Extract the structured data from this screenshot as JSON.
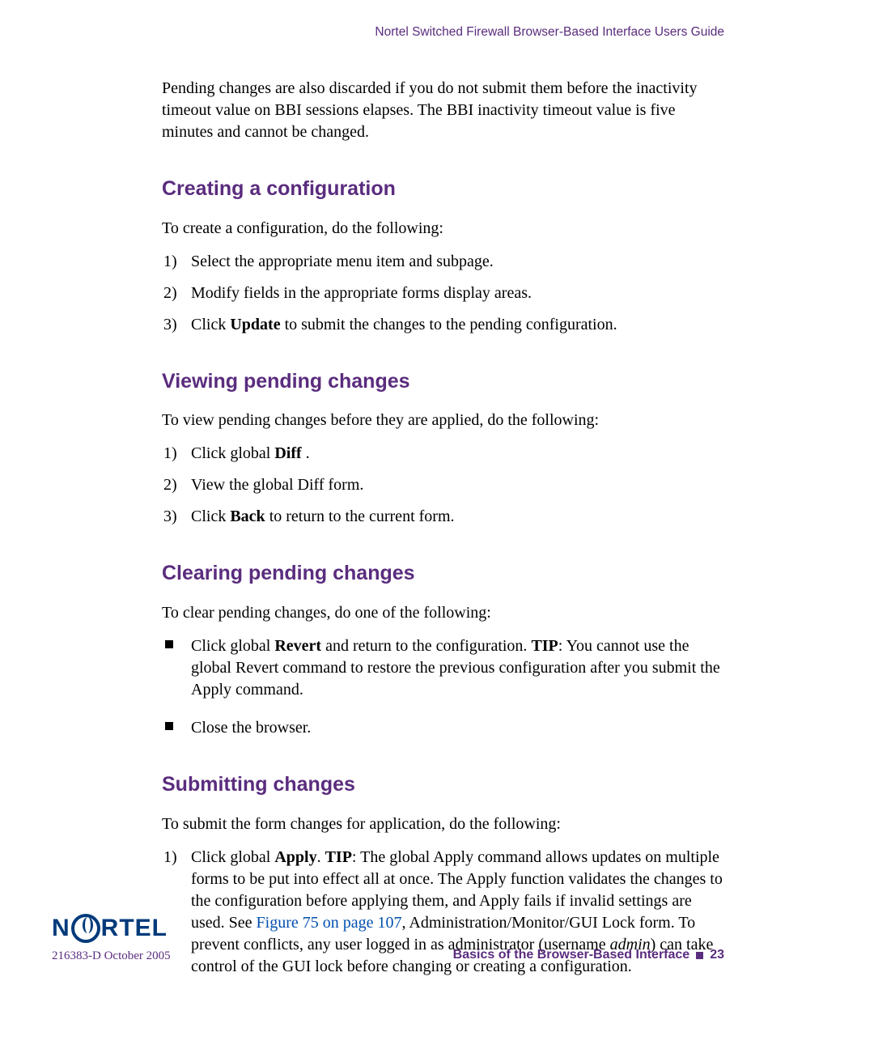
{
  "header": {
    "running_title": "Nortel Switched Firewall Browser-Based Interface Users Guide"
  },
  "intro": "Pending changes are also discarded if you do not submit them before the inactivity timeout value on BBI sessions elapses. The BBI inactivity timeout value is five minutes and cannot be changed.",
  "sections": {
    "creating": {
      "title": "Creating a configuration",
      "lead": "To create a configuration, do the following:",
      "steps": [
        "Select the appropriate menu item and subpage.",
        "Modify fields in the appropriate forms display areas.",
        {
          "pre": "Click ",
          "bold": "Update",
          "post": " to submit the changes to the pending configuration."
        }
      ]
    },
    "viewing": {
      "title": "Viewing pending changes",
      "lead": "To view pending changes before they are applied, do the following:",
      "steps": [
        {
          "pre": "Click global ",
          "bold": "Diff",
          "post": " ."
        },
        "View the global Diff form.",
        {
          "pre": "Click ",
          "bold": "Back",
          "post": " to return to the current form."
        }
      ]
    },
    "clearing": {
      "title": "Clearing pending changes",
      "lead": "To clear pending changes, do one of the following:",
      "bullets": [
        {
          "pre": "Click global ",
          "bold1": "Revert",
          "mid": " and return to the configuration. ",
          "bold2": "TIP",
          "post": ": You cannot use the global Revert command to restore the previous configuration after you submit the Apply command."
        },
        "Close the browser."
      ]
    },
    "submitting": {
      "title": "Submitting changes",
      "lead": "To submit the form changes for application, do the following:",
      "step1": {
        "pre": "Click  global ",
        "bold1": "Apply",
        "mid1": ". ",
        "bold2": "TIP",
        "mid2": ": The global Apply command allows updates on multiple forms to be put into effect all at once. The Apply function validates the changes to the configuration before applying them, and Apply fails if invalid settings are used. See ",
        "link": "Figure 75 on page 107",
        "mid3": ", Administration/Monitor/GUI Lock form. To prevent conflicts, any user logged in as administrator (username ",
        "italic": "admin",
        "post": ") can take control of the GUI lock before changing or creating a configuration."
      }
    }
  },
  "footer": {
    "logo_left": "N",
    "logo_right": "RTEL",
    "pubinfo": "216383-D October 2005",
    "chapter_title": "Basics of the Browser-Based Interface",
    "page_number": "23"
  }
}
